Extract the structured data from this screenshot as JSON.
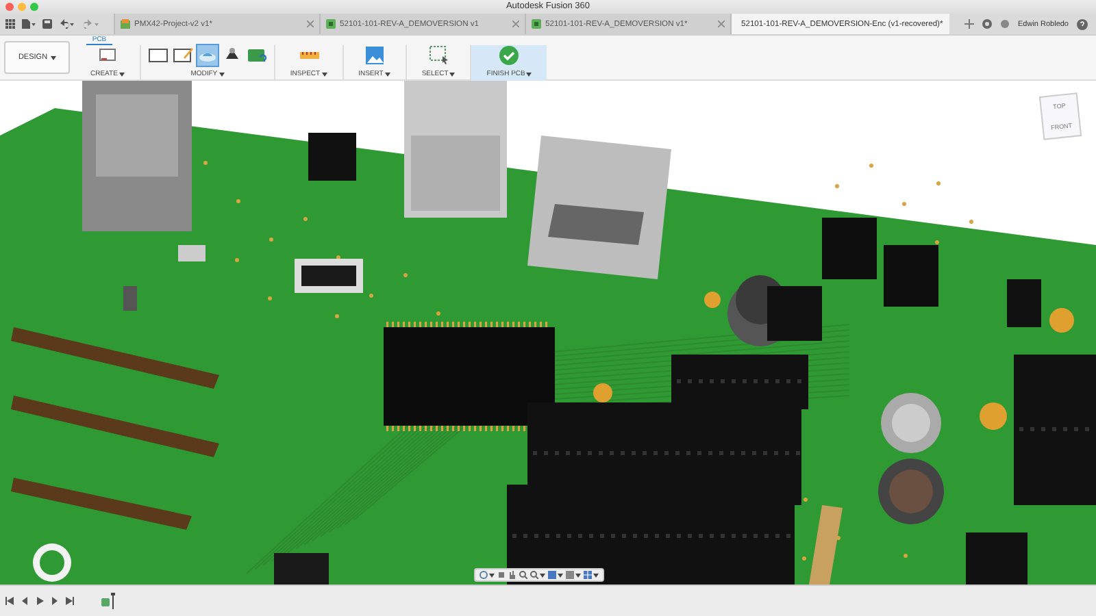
{
  "window": {
    "title": "Autodesk Fusion 360"
  },
  "tabs": [
    {
      "label": "PMX42-Project-v2 v1*",
      "selected": false,
      "kind": "project"
    },
    {
      "label": "52101-101-REV-A_DEMOVERSION v1",
      "selected": false,
      "kind": "board"
    },
    {
      "label": "52101-101-REV-A_DEMOVERSION v1*",
      "selected": false,
      "kind": "board"
    },
    {
      "label": "52101-101-REV-A_DEMOVERSION-Enc (v1-recovered)*",
      "selected": true,
      "kind": "model"
    }
  ],
  "user": {
    "name": "Edwin Robledo"
  },
  "workspace": {
    "label": "DESIGN"
  },
  "toolbar": {
    "tab": "PCB",
    "groups": [
      {
        "label": "CREATE",
        "highlighted": false,
        "tools": [
          {
            "kind": "sketch",
            "selected": false
          }
        ]
      },
      {
        "label": "MODIFY",
        "highlighted": false,
        "tools": [
          {
            "kind": "outline",
            "selected": false
          },
          {
            "kind": "edit",
            "selected": false
          },
          {
            "kind": "board",
            "selected": true
          },
          {
            "kind": "component",
            "selected": false
          },
          {
            "kind": "pcb",
            "selected": false
          }
        ]
      },
      {
        "label": "INSPECT",
        "highlighted": false,
        "tools": [
          {
            "kind": "ruler",
            "selected": false
          }
        ]
      },
      {
        "label": "INSERT",
        "highlighted": false,
        "tools": [
          {
            "kind": "image",
            "selected": false
          }
        ]
      },
      {
        "label": "SELECT",
        "highlighted": false,
        "tools": [
          {
            "kind": "select",
            "selected": false
          }
        ]
      },
      {
        "label": "FINISH PCB",
        "highlighted": true,
        "tools": [
          {
            "kind": "finish",
            "selected": false
          }
        ]
      }
    ]
  },
  "viewcube": {
    "top": "TOP",
    "front": "FRONT"
  }
}
